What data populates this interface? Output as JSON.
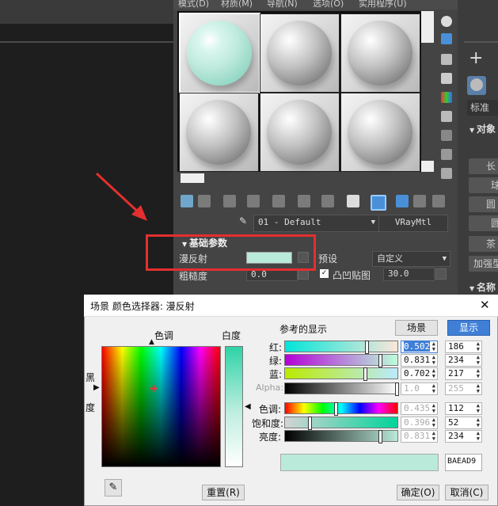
{
  "menubar": {
    "items": [
      "模式(D)",
      "材质(M)",
      "导航(N)",
      "选项(O)",
      "实用程序(U)"
    ]
  },
  "material_editor": {
    "material_name": "01 - Default",
    "material_type": "VRayMtl",
    "rollout_title": "基础参数",
    "diffuse_label": "漫反射",
    "roughness_label": "粗糙度",
    "roughness_value": "0.0",
    "preset_label": "预设",
    "preset_value": "自定义",
    "bump_label": "凸凹贴图",
    "bump_value": "30.0"
  },
  "command_panel": {
    "plus_icon": "+",
    "label_standard": "标准基",
    "rollout_object": "对象",
    "buttons": [
      "长",
      "球",
      "圆",
      "圆",
      "茶"
    ],
    "button_more": "加强型",
    "rollout_name": "名称"
  },
  "dialog": {
    "title": "场景 颜色选择器: 漫反射",
    "hue_label": "色调",
    "whiteness_label": "白度",
    "black_label_1": "黑",
    "black_label_2": "度",
    "reference_label": "参考的显示",
    "scene_button": "场景",
    "display_button": "显示",
    "rows": [
      {
        "label": "红:",
        "value": "0.502",
        "int": "186"
      },
      {
        "label": "绿:",
        "value": "0.831",
        "int": "234"
      },
      {
        "label": "蓝:",
        "value": "0.702",
        "int": "217"
      },
      {
        "label": "Alpha:",
        "value": "1.0",
        "int": "255"
      },
      {
        "label": "色调:",
        "value": "0.435",
        "int": "112"
      },
      {
        "label": "饱和度:",
        "value": "0.396",
        "int": "52"
      },
      {
        "label": "亮度:",
        "value": "0.831",
        "int": "234"
      }
    ],
    "hex": "BAEAD9",
    "color": "#BAEAD9",
    "reset_button": "重置(R)",
    "ok_button": "确定(O)",
    "cancel_button": "取消(C)",
    "close_symbol": "✕"
  },
  "accent": "#e32f2f"
}
